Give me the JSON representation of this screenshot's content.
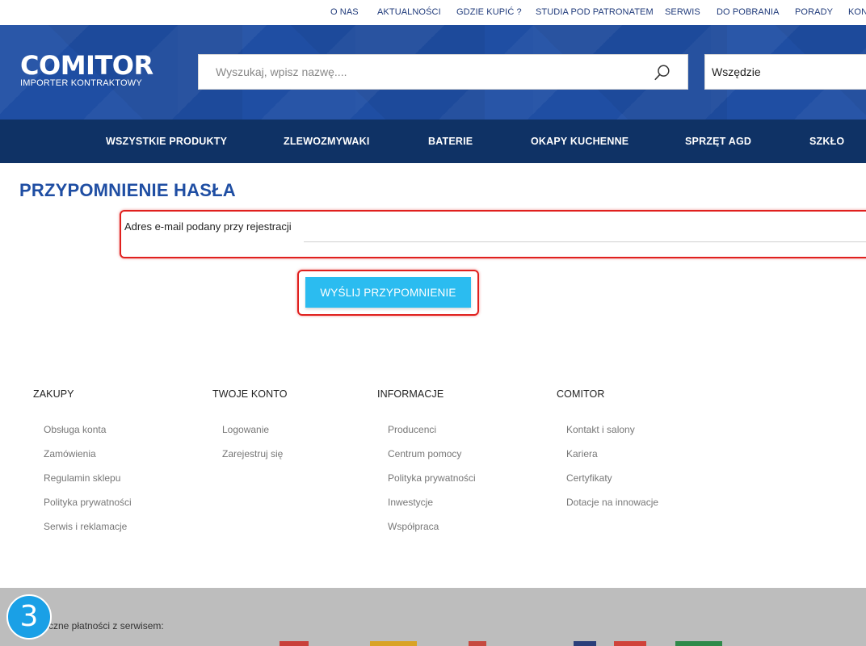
{
  "topnav": [
    "O NAS",
    "AKTUALNOŚCI",
    "GDZIE KUPIĆ ?",
    "STUDIA POD PATRONATEM",
    "SERWIS",
    "DO POBRANIA",
    "PORADY",
    "KONTAKT"
  ],
  "logo": {
    "brand": "COMITOR",
    "reg": "®",
    "tagline": "IMPORTER KONTRAKTOWY"
  },
  "search": {
    "placeholder": "Wyszukaj, wpisz nazwę....",
    "scope": "Wszędzie"
  },
  "mainnav": [
    "WSZYSTKIE PRODUKTY",
    "ZLEWOZMYWAKI",
    "BATERIE",
    "OKAPY KUCHENNE",
    "SPRZĘT AGD",
    "SZKŁO"
  ],
  "page": {
    "title": "PRZYPOMNIENIE HASŁA",
    "email_label": "Adres e-mail podany przy rejestracji",
    "email_value": "",
    "submit": "WYŚLIJ PRZYPOMNIENIE"
  },
  "footer": [
    {
      "title": "ZAKUPY",
      "links": [
        "Obsługa konta",
        "Zamówienia",
        "Regulamin sklepu",
        "Polityka prywatności",
        "Serwis i reklamacje"
      ]
    },
    {
      "title": "TWOJE KONTO",
      "links": [
        "Logowanie",
        "Zarejestruj się"
      ]
    },
    {
      "title": "INFORMACJE",
      "links": [
        "Producenci",
        "Centrum pomocy",
        "Polityka prywatności",
        "Inwestycje",
        "Współpraca"
      ]
    },
    {
      "title": "COMITOR",
      "links": [
        "Kontakt i salony",
        "Kariera",
        "Certyfikaty",
        "Dotacje na innowacje"
      ]
    }
  ],
  "band": {
    "text": "czne płatności z serwisem:"
  },
  "step_badge": "3",
  "colors": {
    "header": "#1f4ea3",
    "nav": "#0f3265",
    "button": "#2bbcf0",
    "highlight": "#e0201e"
  }
}
